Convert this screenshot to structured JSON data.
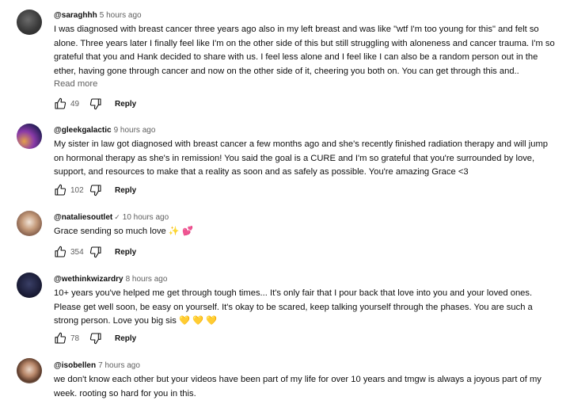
{
  "comments": [
    {
      "handle": "@saraghhh",
      "time": "5 hours ago",
      "verified": false,
      "text": "I was diagnosed with breast cancer three years ago also in my left breast and was like \"wtf I'm too young for this\" and felt so alone. Three years later I finally feel like I'm on the other side of this but still struggling with aloneness and cancer trauma. I'm so grateful that you and Hank decided to share with us. I feel less alone and I feel like I can also be a random person out in the ether, having gone through cancer and now on the other side of it, cheering you both on. You can get through this and..",
      "emoji": "",
      "read_more": "Read more",
      "likes": "49",
      "reply": "Reply"
    },
    {
      "handle": "@gleekgalactic",
      "time": "9 hours ago",
      "verified": false,
      "text": "My sister in law got diagnosed with breast cancer a few months ago and she's recently finished radiation therapy and will jump on hormonal therapy as she's in remission! You said the goal is a CURE and I'm so grateful that you're surrounded by love, support, and resources to make that a reality as soon and as safely as possible. You're amazing Grace <3",
      "emoji": "",
      "likes": "102",
      "reply": "Reply"
    },
    {
      "handle": "@nataliesoutlet",
      "time": "10 hours ago",
      "verified": true,
      "text": "Grace sending so much love",
      "emoji": "✨ 💕",
      "likes": "354",
      "reply": "Reply"
    },
    {
      "handle": "@wethinkwizardry",
      "time": "8 hours ago",
      "verified": false,
      "text": "10+ years you've helped me get through tough times... It's only fair that I pour back that love into you and your loved ones. Please get well soon, be easy on yourself. It's okay to be scared, keep talking yourself through the phases. You are such a strong person. Love you big sis",
      "emoji": "💛 💛 💛",
      "likes": "78",
      "reply": "Reply"
    },
    {
      "handle": "@isobellen",
      "time": "7 hours ago",
      "verified": false,
      "text": "we don't know each other but your videos have been part of my life for over 10 years and tmgw is always a joyous part of my week. rooting so hard for you in this.",
      "emoji": ""
    }
  ]
}
